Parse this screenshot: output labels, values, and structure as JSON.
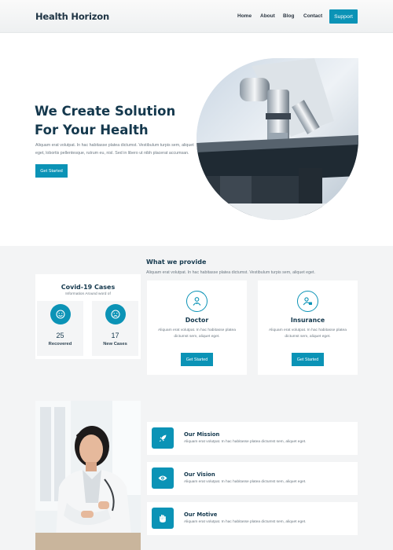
{
  "nav": {
    "brand": "Health Horizon",
    "links": [
      "Home",
      "About",
      "Blog",
      "Contact"
    ],
    "support_label": "Support"
  },
  "hero": {
    "title": "We Create Solution For Your Health",
    "text": "Aliquam erat volutpat. In hac habitasse platea dictumst. Vestibulum turpis sem, aliquet eget, lobortis pellentesque, rutrum eu, nisl. Sed in libero ut nibh placerat accumsan.",
    "button_label": "Get Started"
  },
  "provide": {
    "title": "What we provide",
    "subtitle": "Aliquam erat volutpat. In hac habitasse platea dictumst. Vestibulum turpis sem, aliquet eget."
  },
  "covid": {
    "title": "Covid-19 Cases",
    "subtitle": "Information Around word of",
    "stats": [
      {
        "value": "25",
        "label": "Recovered",
        "icon": "smile-icon"
      },
      {
        "value": "17",
        "label": "New Cases",
        "icon": "sad-face-icon"
      }
    ]
  },
  "cards": [
    {
      "title": "Doctor",
      "text": "Aliquam erat volutpat. In hac habitasse platea dictumst sem, aliquet eget.",
      "button_label": "Get Started",
      "icon": "doctor-icon"
    },
    {
      "title": "Insurance",
      "text": "Aliquam erat volutpat. In hac habitasse platea dictumst sem, aliquet eget.",
      "button_label": "Get Started",
      "icon": "insurance-icon"
    }
  ],
  "features": [
    {
      "title": "Our Mission",
      "text": "Aliquam erat volutpat. In hac habitasse platea dictumst sem, aliquet eget.",
      "icon": "rocket-icon"
    },
    {
      "title": "Our Vision",
      "text": "Aliquam erat volutpat. In hac habitasse platea dictumst sem, aliquet eget.",
      "icon": "eye-icon"
    },
    {
      "title": "Our Motive",
      "text": "Aliquam erat volutpat. In hac habitasse platea dictumst sem, aliquet eget.",
      "icon": "hand-icon"
    }
  ],
  "colors": {
    "accent": "#0b93b6",
    "heading": "#14384d",
    "section_bg": "#f3f4f5"
  }
}
